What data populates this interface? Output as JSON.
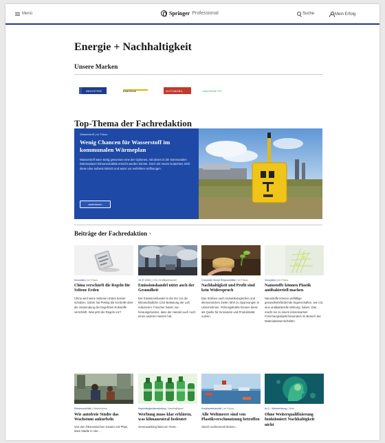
{
  "header": {
    "menu_label": "Menü",
    "logo_brand": "Springer",
    "logo_suffix": "Professional",
    "search_label": "Suche",
    "login_label": "Mein Erfolg"
  },
  "page": {
    "title": "Energie + Nachhaltigkeit",
    "brands_heading": "Unsere Marken",
    "brands": [
      "INDUSTRIE",
      "ENERGIE",
      "AUTOMOBIL",
      "NACHHALTIG"
    ],
    "top_heading": "Top-Thema der Fachredaktion",
    "contributions_heading": "Beiträge der Fachredaktion",
    "contributions_arrow": "›"
  },
  "hero": {
    "meta": "Wasserstoff | im Fokus",
    "title": "Wenig Chancen für Wasserstoff im kommunalen Wärmeplan",
    "text": "Wasserstoff wäre stetig gewonnen eine der Optionen, mit denen in der kommunalen Wärmeplanei Klimaneutralität erreicht werden könnte. Doch ein neues Gutachten zieht diese Idee äußerst kritisch und warnt vor verfehlten Hoffnungen.",
    "button": "weiterlesen"
  },
  "cards": [
    {
      "meta_cat": "Innovation",
      "meta_rest": " | im Fokus",
      "title": "China verschärft die Regeln für Seltene Erden",
      "text": "China wird seine Seltenen Erden besser schützen. Daher hat Peking die Kontrolle über die Verwendung der begehrten Rohstoffe verschärft. Was jetzt die Regeln vor?"
    },
    {
      "meta_cat": "10.07.2024",
      "meta_rest": " | CO2-Zertifikatehandel",
      "title": "Emissionshandel nützt auch der Gesundheit",
      "text": "Der Emissionshandel in der EU zur die klimaschädliche CO2-Belastung der Luft reduzieren. Forscher haben nun herausgefunden, dass der Handel auch noch einen anderen Nutzen hat."
    },
    {
      "meta_cat": "Corporate Social Responsibility",
      "meta_rest": " | im Fokus",
      "title": "Nachhaltigkeit und Profit sind kein Widerspruch",
      "text": "Das Streben nach sozialökologischen und ökonomischen Zielen führt zu Spannungen in Unternehmen. Führungskräfte können diese als Quelle für Innovation und Produktivität nutzen."
    },
    {
      "meta_cat": "Innovation",
      "meta_rest": " | im Fokus",
      "title": "Nanostoffe können Plastik antibakteriell machen",
      "text": "Nanostoffe können vielfältige gesundheitsfördernde Eigenschaften, wie z.B. eine antibakterielle Wirkung, haben. Das macht sie zu einem interessanten Forschungsobjekt besonders im Bereich der Materialwissenschaften."
    },
    {
      "meta_cat": "Elektromobilität",
      "meta_rest": " | Stadtverkehr",
      "title": "Wie autofreie Städte das Wachstum ankurbeln",
      "text": "Von den Ökonomischen Gewinn mit Platz, dass Städte in vier..."
    },
    {
      "meta_cat": "Nachhaltigkeitsmarketing",
      "meta_rest": " | Nachhaltigkeit",
      "title": "Werbung muss klar erklären, was klimaneutral bedeutet",
      "text": "Greenwashing lässt ein Treet..."
    },
    {
      "meta_cat": "Kreislaufwirtschaft",
      "meta_rest": " | im Fokus",
      "title": "Alle Weltmeere sind von Plastikverschmutzung betroffen",
      "text": "Gleich verheerend kleinen..."
    },
    {
      "meta_cat": "ALS - Weiterbildung",
      "meta_rest": " | Ziele...",
      "title": "Ohne Weiterqualifizierung funktioniert Nachhaltigkeit nicht",
      "text": ""
    }
  ],
  "colors": {
    "brand_blue": "#1c3a8a",
    "hero_blue": "#1f49a6"
  }
}
